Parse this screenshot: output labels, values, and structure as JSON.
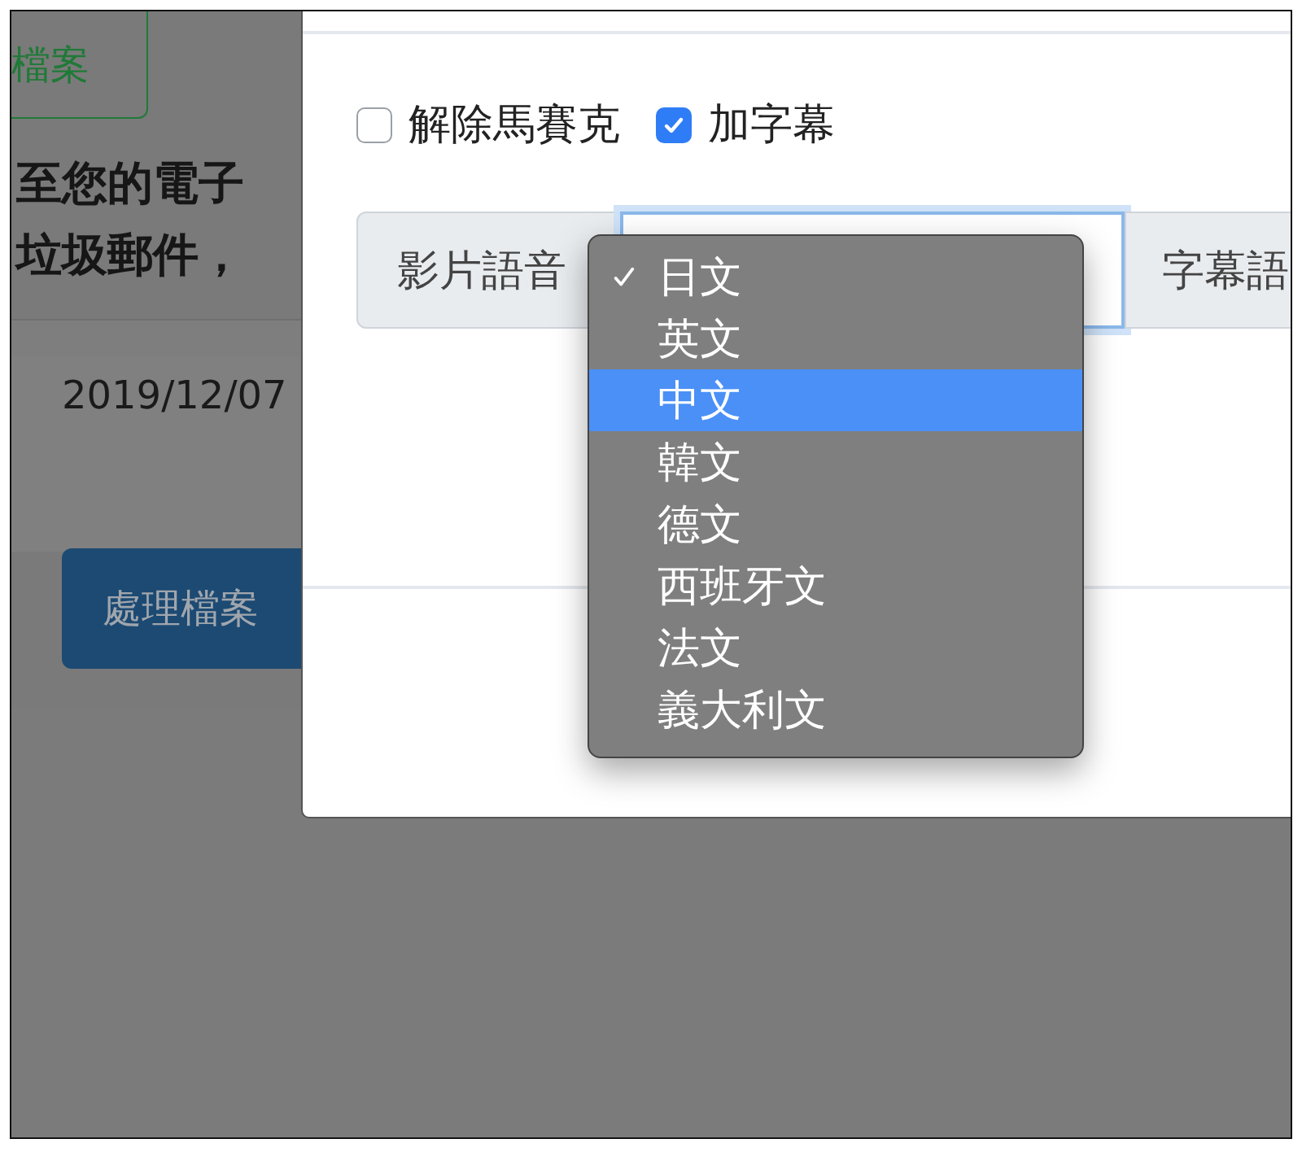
{
  "background": {
    "outline_button": "檔案",
    "message_lines": [
      "至您的電子",
      "垃圾郵件，"
    ],
    "date": "2019/12/07",
    "process_button": "處理檔案"
  },
  "modal": {
    "checkboxes": [
      {
        "label": "解除馬賽克",
        "checked": false
      },
      {
        "label": "加字幕",
        "checked": true
      }
    ],
    "audio_label": "影片語音",
    "subtitle_label": "字幕語"
  },
  "dropdown": {
    "options": [
      {
        "label": "日文",
        "checked": true,
        "highlighted": false
      },
      {
        "label": "英文",
        "checked": false,
        "highlighted": false
      },
      {
        "label": "中文",
        "checked": false,
        "highlighted": true
      },
      {
        "label": "韓文",
        "checked": false,
        "highlighted": false
      },
      {
        "label": "德文",
        "checked": false,
        "highlighted": false
      },
      {
        "label": "西班牙文",
        "checked": false,
        "highlighted": false
      },
      {
        "label": "法文",
        "checked": false,
        "highlighted": false
      },
      {
        "label": "義大利文",
        "checked": false,
        "highlighted": false
      }
    ]
  }
}
